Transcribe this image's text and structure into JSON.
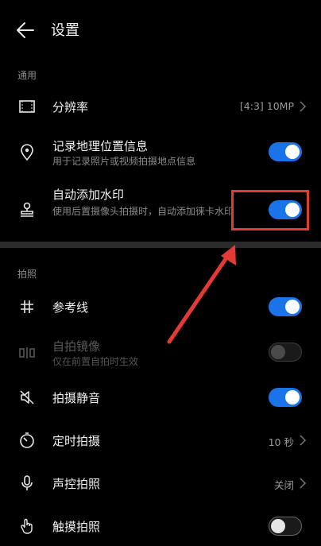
{
  "header": {
    "title": "设置"
  },
  "sections": {
    "general": "通用",
    "photo": "拍照"
  },
  "rows": {
    "resolution": {
      "label": "分辨率",
      "value": "[4:3] 10MP"
    },
    "location": {
      "label": "记录地理位置信息",
      "sub": "用于记录照片或视频拍摄地点信息",
      "state": "on"
    },
    "watermark": {
      "label": "自动添加水印",
      "sub": "使用后置摄像头拍摄时，自动添加徕卡水印",
      "state": "on"
    },
    "gridline": {
      "label": "参考线",
      "state": "on"
    },
    "mirror": {
      "label": "自拍镜像",
      "sub": "仅在前置自拍时生效",
      "state": "off-disabled"
    },
    "mute": {
      "label": "拍摄静音",
      "state": "on"
    },
    "timer": {
      "label": "定时拍摄",
      "value": "10 秒"
    },
    "voice": {
      "label": "声控拍照",
      "value": "关闭"
    },
    "touch": {
      "label": "触摸拍照",
      "state": "off"
    }
  },
  "colors": {
    "accent": "#1a73e8",
    "annotation": "#e53935"
  }
}
